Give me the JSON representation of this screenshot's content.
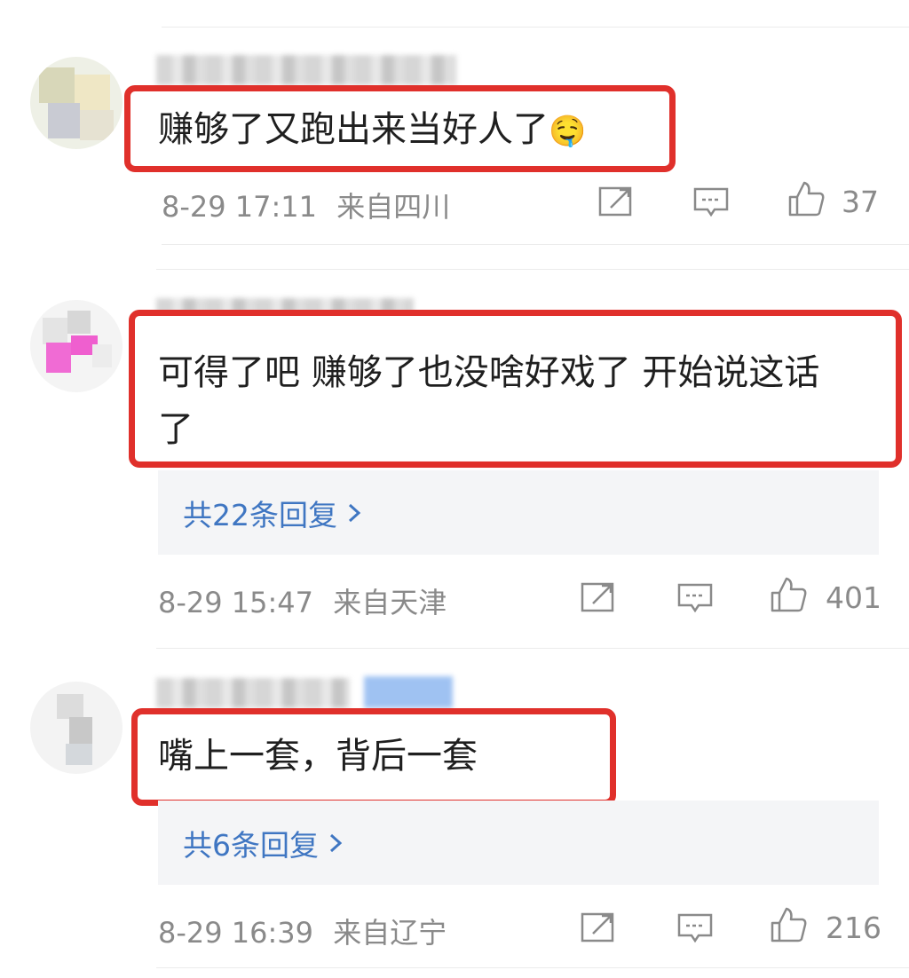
{
  "comments": [
    {
      "text": "赚够了又跑出来当好人了",
      "emoji": "🤤",
      "time": "8-29 17:11",
      "location": "来自四川",
      "likes": "37",
      "accent": "#e0302b"
    },
    {
      "text_line1": "可得了吧 赚够了也没啥好戏了 开始说这话",
      "text_line2": "了",
      "reply_label": "共22条回复",
      "time": "8-29 15:47",
      "location": "来自天津",
      "likes": "401"
    },
    {
      "text": "嘴上一套，背后一套",
      "reply_label": "共6条回复",
      "time": "8-29 16:39",
      "location": "来自辽宁",
      "likes": "216"
    }
  ],
  "icons": {
    "share": "share-icon",
    "comment": "comment-icon",
    "like": "thumbs-up-icon",
    "chevron": "chevron-right-icon"
  },
  "colors": {
    "highlight": "#e0302b",
    "link": "#3f76c2",
    "meta": "#8a8a8a",
    "reply_bg": "#f4f5f7"
  }
}
